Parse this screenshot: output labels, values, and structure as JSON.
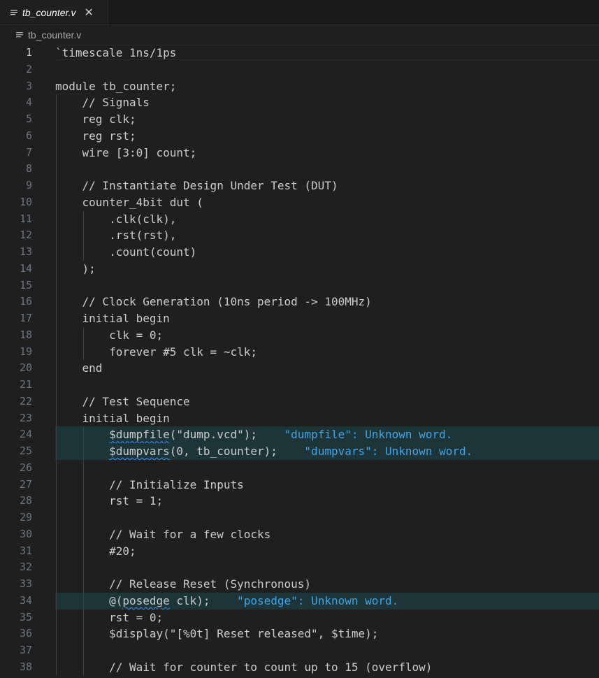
{
  "tab": {
    "label": "tb_counter.v",
    "close_glyph": "✕",
    "icon": "file-lines-icon"
  },
  "breadcrumb": {
    "label": "tb_counter.v",
    "icon": "file-lines-icon"
  },
  "active_line": 1,
  "lines": [
    {
      "n": "1",
      "pre": "`timescale 1ns/1ps"
    },
    {
      "n": "2",
      "pre": ""
    },
    {
      "n": "3",
      "pre": "module tb_counter;"
    },
    {
      "n": "4",
      "pre": "    // Signals"
    },
    {
      "n": "5",
      "pre": "    reg clk;"
    },
    {
      "n": "6",
      "pre": "    reg rst;"
    },
    {
      "n": "7",
      "pre": "    wire [3:0] count;"
    },
    {
      "n": "8",
      "pre": ""
    },
    {
      "n": "9",
      "pre": "    // Instantiate Design Under Test (DUT)"
    },
    {
      "n": "10",
      "pre": "    counter_4bit dut ("
    },
    {
      "n": "11",
      "pre": "        .clk(clk),"
    },
    {
      "n": "12",
      "pre": "        .rst(rst),"
    },
    {
      "n": "13",
      "pre": "        .count(count)"
    },
    {
      "n": "14",
      "pre": "    );"
    },
    {
      "n": "15",
      "pre": ""
    },
    {
      "n": "16",
      "pre": "    // Clock Generation (10ns period -> 100MHz)"
    },
    {
      "n": "17",
      "pre": "    initial begin"
    },
    {
      "n": "18",
      "pre": "        clk = 0;"
    },
    {
      "n": "19",
      "pre": "        forever #5 clk = ~clk;"
    },
    {
      "n": "20",
      "pre": "    end"
    },
    {
      "n": "21",
      "pre": ""
    },
    {
      "n": "22",
      "pre": "    // Test Sequence"
    },
    {
      "n": "23",
      "pre": "    initial begin"
    },
    {
      "n": "24",
      "pre": "        ",
      "sq": "$dumpfile",
      "post": "(\"dump.vcd\");",
      "diag": "    \"dumpfile\": Unknown word."
    },
    {
      "n": "25",
      "pre": "        ",
      "sq": "$dumpvars",
      "post": "(0, tb_counter);",
      "diag": "    \"dumpvars\": Unknown word."
    },
    {
      "n": "26",
      "pre": ""
    },
    {
      "n": "27",
      "pre": "        // Initialize Inputs"
    },
    {
      "n": "28",
      "pre": "        rst = 1;"
    },
    {
      "n": "29",
      "pre": ""
    },
    {
      "n": "30",
      "pre": "        // Wait for a few clocks"
    },
    {
      "n": "31",
      "pre": "        #20;"
    },
    {
      "n": "32",
      "pre": ""
    },
    {
      "n": "33",
      "pre": "        // Release Reset (Synchronous)"
    },
    {
      "n": "34",
      "pre": "        @(",
      "sq": "posedge",
      "post": " clk);",
      "diag": "    \"posedge\": Unknown word."
    },
    {
      "n": "35",
      "pre": "        rst = 0;"
    },
    {
      "n": "36",
      "pre": "        $display(\"[%0t] Reset released\", $time);"
    },
    {
      "n": "37",
      "pre": ""
    },
    {
      "n": "38",
      "pre": "        // Wait for counter to count up to 15 (overflow)"
    }
  ]
}
